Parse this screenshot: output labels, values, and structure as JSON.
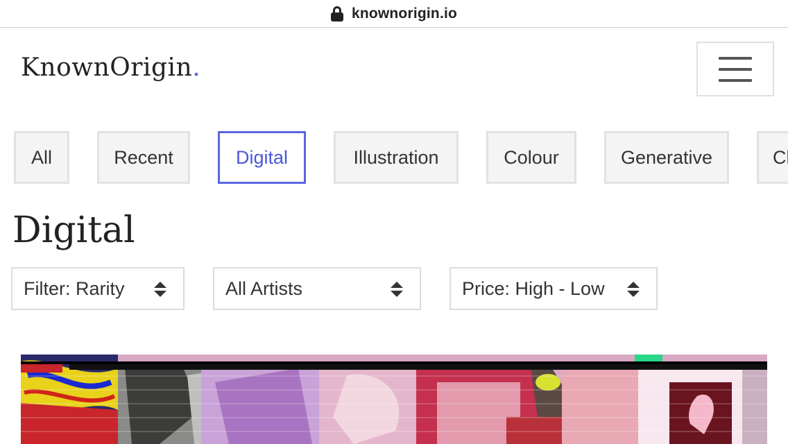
{
  "browser": {
    "url": "knownorigin.io"
  },
  "header": {
    "logo_text": "KnownOrigin",
    "logo_dot": ".",
    "menu_icon": "hamburger-menu-icon"
  },
  "categories": [
    {
      "label": "All",
      "active": false
    },
    {
      "label": "Recent",
      "active": false
    },
    {
      "label": "Digital",
      "active": true
    },
    {
      "label": "Illustration",
      "active": false
    },
    {
      "label": "Colour",
      "active": false
    },
    {
      "label": "Generative",
      "active": false
    },
    {
      "label": "Cl",
      "active": false
    }
  ],
  "page": {
    "title": "Digital"
  },
  "filters": {
    "rarity": "Filter: Rarity",
    "artists": "All Artists",
    "price": "Price: High - Low"
  },
  "colors": {
    "accent": "#5b66e0",
    "tab_bg": "#f4f4f4",
    "tab_border": "#e2e2e2"
  }
}
